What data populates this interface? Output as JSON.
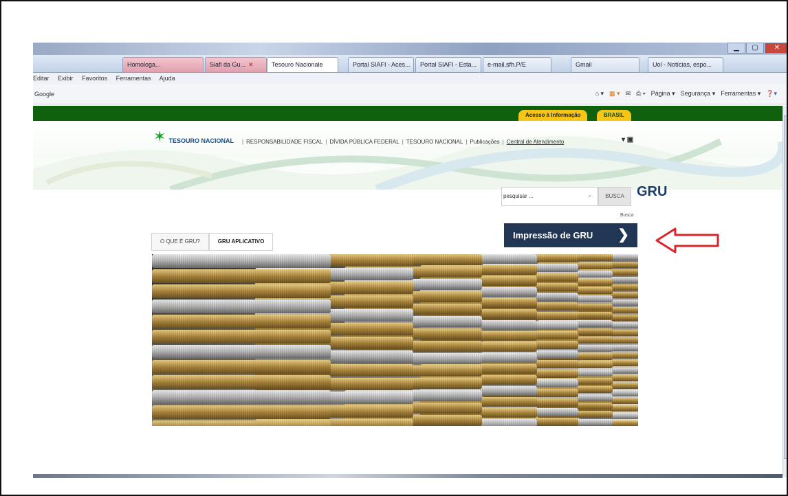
{
  "browser": {
    "tabs": [
      {
        "label": "Homologa...",
        "close": "✕",
        "style": "pink"
      },
      {
        "label": "Siafi da Gu...",
        "close": "✕",
        "style": "pink"
      },
      {
        "label": "Tesouro Nacionale",
        "close": "✕",
        "style": "active"
      },
      {
        "label": "Portal SIAFI - Aces...",
        "close": "",
        "style": "normal"
      },
      {
        "label": "Portal SIAFI - Esta...",
        "close": "",
        "style": "normal"
      },
      {
        "label": "e-mail.sfh.P/E",
        "close": "",
        "style": "normal"
      },
      {
        "label": "Gmail",
        "close": "",
        "style": "normal"
      },
      {
        "label": "Uol - Notícias, espo...",
        "close": "",
        "style": "normal"
      }
    ],
    "menu": [
      "Editar",
      "Exibir",
      "Favoritos",
      "Ferramentas",
      "Ajuda"
    ],
    "favorites_label": "Google",
    "tools": [
      "Página ▾",
      "Segurança ▾",
      "Ferramentas ▾"
    ]
  },
  "site": {
    "top_links": {
      "gov": "Acesso à Informação",
      "brasil": "BRASIL"
    },
    "logo_name": "TESOURO NACIONAL",
    "nav": [
      "RESPONSABILIDADE FISCAL",
      "DÍVIDA PÚBLICA FEDERAL",
      "TESOURO NACIONAL",
      "Publicações",
      "Central de Atendimento"
    ],
    "social_icons": "▾ ▣",
    "search_placeholder": "pesquisar ...",
    "search_button": "BUSCA",
    "page_title": "GRU",
    "small_note": "Busca",
    "subtabs": [
      "O QUE É GRU?",
      "GRU APLICATIVO"
    ],
    "cta_button": "Impressão de GRU",
    "cta_chevron": "❯"
  },
  "colors": {
    "gov_green": "#10610e",
    "gov_yellow": "#f5c518",
    "cta_navy": "#213654",
    "annotation_red": "#d9252a"
  }
}
